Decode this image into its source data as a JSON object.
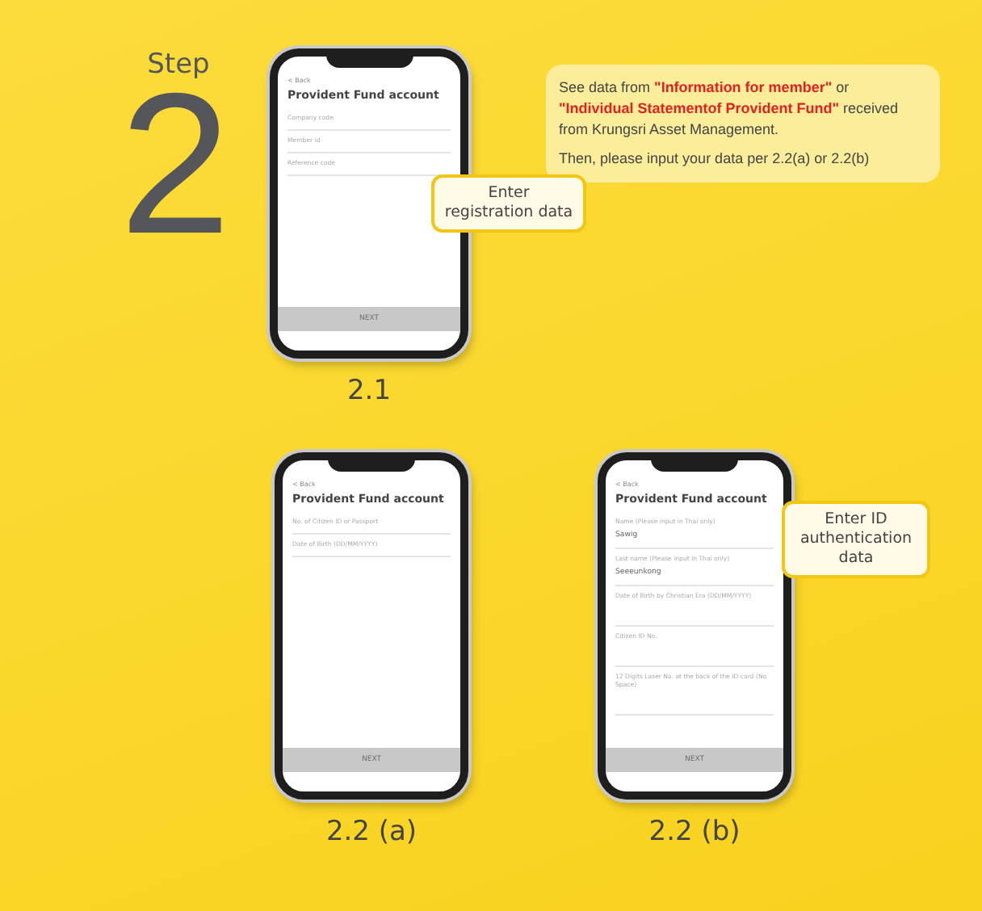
{
  "step": {
    "word": "Step",
    "number": "2"
  },
  "note": {
    "text": "See data from **\"Information for member\"** or **\"Individual Statementof Provident Fund\"** received from Krungsri Asset Management.",
    "instruction": "Then, please input your data per 2.2(a) or 2.2(b)"
  },
  "phones": [
    {
      "label": "2.1",
      "back": "< Back",
      "title": "Provident Fund account",
      "fields": [
        {
          "kind": "line",
          "label": "Company code"
        },
        {
          "kind": "line",
          "label": "Member id"
        },
        {
          "kind": "line",
          "label": "Reference code"
        }
      ],
      "button": "NEXT",
      "callout": {
        "text": "Enter registration data"
      }
    },
    {
      "label": "2.2 (a)",
      "back": "< Back",
      "title": "Provident Fund account",
      "fields": [
        {
          "kind": "line",
          "label": "No. of Citizen ID or Passport"
        },
        {
          "kind": "line",
          "label": "Date of Birth (DD/MM/YYYY)"
        }
      ],
      "button": "NEXT"
    },
    {
      "label": "2.2 (b)",
      "back": "< Back",
      "title": "Provident Fund account",
      "fields": [
        {
          "kind": "entry",
          "label": "Name (Please input in Thai only)",
          "value": "Sawig"
        },
        {
          "kind": "entry",
          "label": "Last name (Please input in Thai only)",
          "value": "Seeeunkong"
        },
        {
          "kind": "entry",
          "label": "Date of Birth by Christian Era (DD/MM/YYYY)"
        },
        {
          "kind": "entry",
          "label": "Citizen ID No."
        },
        {
          "kind": "entry",
          "label": "12 Digits Laser No. at the back of the ID card (No Space)"
        }
      ],
      "button": "NEXT",
      "callout": {
        "text": "Enter ID authentication data"
      }
    }
  ]
}
